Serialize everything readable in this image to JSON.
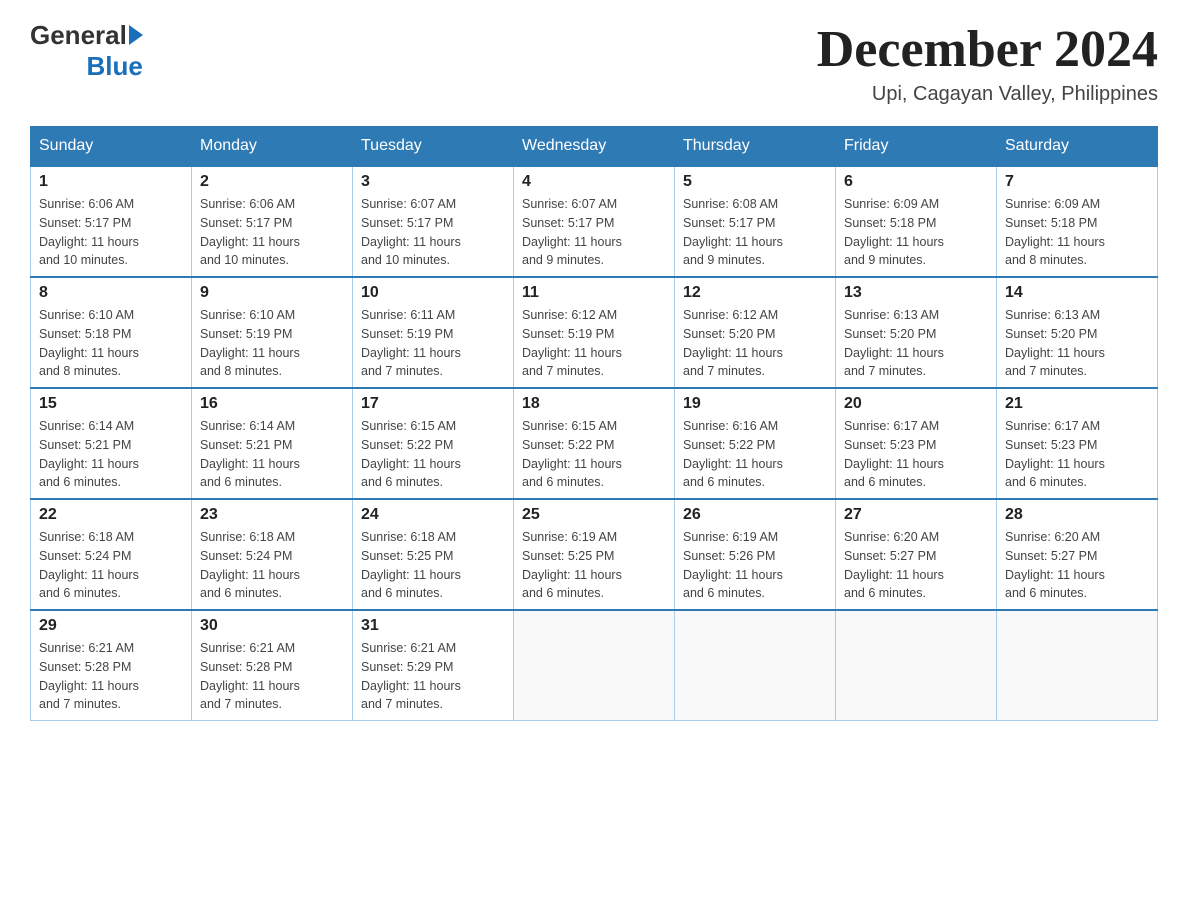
{
  "header": {
    "logo_general": "General",
    "logo_blue": "Blue",
    "title": "December 2024",
    "subtitle": "Upi, Cagayan Valley, Philippines"
  },
  "days_of_week": [
    "Sunday",
    "Monday",
    "Tuesday",
    "Wednesday",
    "Thursday",
    "Friday",
    "Saturday"
  ],
  "weeks": [
    [
      {
        "day": "1",
        "sunrise": "6:06 AM",
        "sunset": "5:17 PM",
        "daylight": "11 hours and 10 minutes."
      },
      {
        "day": "2",
        "sunrise": "6:06 AM",
        "sunset": "5:17 PM",
        "daylight": "11 hours and 10 minutes."
      },
      {
        "day": "3",
        "sunrise": "6:07 AM",
        "sunset": "5:17 PM",
        "daylight": "11 hours and 10 minutes."
      },
      {
        "day": "4",
        "sunrise": "6:07 AM",
        "sunset": "5:17 PM",
        "daylight": "11 hours and 9 minutes."
      },
      {
        "day": "5",
        "sunrise": "6:08 AM",
        "sunset": "5:17 PM",
        "daylight": "11 hours and 9 minutes."
      },
      {
        "day": "6",
        "sunrise": "6:09 AM",
        "sunset": "5:18 PM",
        "daylight": "11 hours and 9 minutes."
      },
      {
        "day": "7",
        "sunrise": "6:09 AM",
        "sunset": "5:18 PM",
        "daylight": "11 hours and 8 minutes."
      }
    ],
    [
      {
        "day": "8",
        "sunrise": "6:10 AM",
        "sunset": "5:18 PM",
        "daylight": "11 hours and 8 minutes."
      },
      {
        "day": "9",
        "sunrise": "6:10 AM",
        "sunset": "5:19 PM",
        "daylight": "11 hours and 8 minutes."
      },
      {
        "day": "10",
        "sunrise": "6:11 AM",
        "sunset": "5:19 PM",
        "daylight": "11 hours and 7 minutes."
      },
      {
        "day": "11",
        "sunrise": "6:12 AM",
        "sunset": "5:19 PM",
        "daylight": "11 hours and 7 minutes."
      },
      {
        "day": "12",
        "sunrise": "6:12 AM",
        "sunset": "5:20 PM",
        "daylight": "11 hours and 7 minutes."
      },
      {
        "day": "13",
        "sunrise": "6:13 AM",
        "sunset": "5:20 PM",
        "daylight": "11 hours and 7 minutes."
      },
      {
        "day": "14",
        "sunrise": "6:13 AM",
        "sunset": "5:20 PM",
        "daylight": "11 hours and 7 minutes."
      }
    ],
    [
      {
        "day": "15",
        "sunrise": "6:14 AM",
        "sunset": "5:21 PM",
        "daylight": "11 hours and 6 minutes."
      },
      {
        "day": "16",
        "sunrise": "6:14 AM",
        "sunset": "5:21 PM",
        "daylight": "11 hours and 6 minutes."
      },
      {
        "day": "17",
        "sunrise": "6:15 AM",
        "sunset": "5:22 PM",
        "daylight": "11 hours and 6 minutes."
      },
      {
        "day": "18",
        "sunrise": "6:15 AM",
        "sunset": "5:22 PM",
        "daylight": "11 hours and 6 minutes."
      },
      {
        "day": "19",
        "sunrise": "6:16 AM",
        "sunset": "5:22 PM",
        "daylight": "11 hours and 6 minutes."
      },
      {
        "day": "20",
        "sunrise": "6:17 AM",
        "sunset": "5:23 PM",
        "daylight": "11 hours and 6 minutes."
      },
      {
        "day": "21",
        "sunrise": "6:17 AM",
        "sunset": "5:23 PM",
        "daylight": "11 hours and 6 minutes."
      }
    ],
    [
      {
        "day": "22",
        "sunrise": "6:18 AM",
        "sunset": "5:24 PM",
        "daylight": "11 hours and 6 minutes."
      },
      {
        "day": "23",
        "sunrise": "6:18 AM",
        "sunset": "5:24 PM",
        "daylight": "11 hours and 6 minutes."
      },
      {
        "day": "24",
        "sunrise": "6:18 AM",
        "sunset": "5:25 PM",
        "daylight": "11 hours and 6 minutes."
      },
      {
        "day": "25",
        "sunrise": "6:19 AM",
        "sunset": "5:25 PM",
        "daylight": "11 hours and 6 minutes."
      },
      {
        "day": "26",
        "sunrise": "6:19 AM",
        "sunset": "5:26 PM",
        "daylight": "11 hours and 6 minutes."
      },
      {
        "day": "27",
        "sunrise": "6:20 AM",
        "sunset": "5:27 PM",
        "daylight": "11 hours and 6 minutes."
      },
      {
        "day": "28",
        "sunrise": "6:20 AM",
        "sunset": "5:27 PM",
        "daylight": "11 hours and 6 minutes."
      }
    ],
    [
      {
        "day": "29",
        "sunrise": "6:21 AM",
        "sunset": "5:28 PM",
        "daylight": "11 hours and 7 minutes."
      },
      {
        "day": "30",
        "sunrise": "6:21 AM",
        "sunset": "5:28 PM",
        "daylight": "11 hours and 7 minutes."
      },
      {
        "day": "31",
        "sunrise": "6:21 AM",
        "sunset": "5:29 PM",
        "daylight": "11 hours and 7 minutes."
      },
      null,
      null,
      null,
      null
    ]
  ],
  "labels": {
    "sunrise": "Sunrise:",
    "sunset": "Sunset:",
    "daylight": "Daylight:"
  }
}
